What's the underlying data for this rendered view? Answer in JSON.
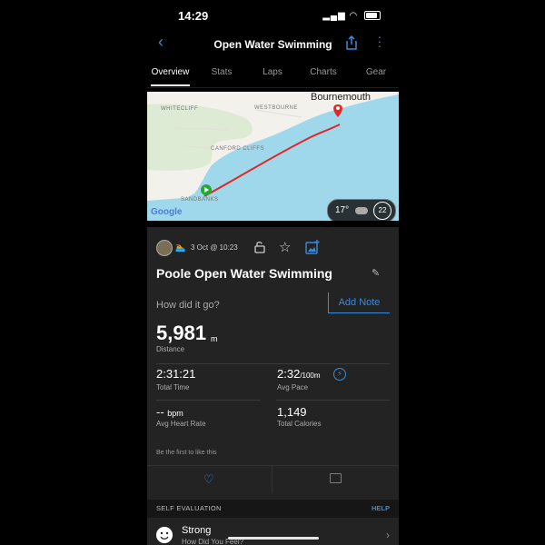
{
  "status": {
    "time": "14:29"
  },
  "nav": {
    "title": "Open Water Swimming"
  },
  "tabs": [
    "Overview",
    "Stats",
    "Laps",
    "Charts",
    "Gear"
  ],
  "map": {
    "labels": [
      "WHITECLIFF",
      "WESTBOURNE",
      "CANFORD CLIFFS",
      "SANDBANKS"
    ],
    "town": "Bournemouth",
    "attribution": "Google",
    "weather": {
      "temp": "17°",
      "wind": "22"
    }
  },
  "activity": {
    "date": "3 Oct @ 10:23",
    "title": "Poole Open Water Swimming",
    "prompt": "How did it go?",
    "add_note": "Add Note"
  },
  "stats": {
    "distance": {
      "value": "5,981",
      "unit": "m",
      "label": "Distance"
    },
    "total_time": {
      "value": "2:31:21",
      "label": "Total Time"
    },
    "avg_pace": {
      "value": "2:32",
      "unit": "/100m",
      "label": "Avg Pace"
    },
    "avg_hr": {
      "value": "--",
      "unit": "bpm",
      "label": "Avg Heart Rate"
    },
    "calories": {
      "value": "1,149",
      "label": "Total Calories"
    }
  },
  "social": {
    "first_like": "Be the first to like this"
  },
  "self_eval": {
    "header": "SELF EVALUATION",
    "help": "HELP",
    "value": "Strong",
    "subtitle": "How Did You Feel?"
  },
  "colors": {
    "accent": "#3a8bd9",
    "route": "#e32626",
    "water": "#9fd8ea",
    "land": "#f3f1ec"
  }
}
